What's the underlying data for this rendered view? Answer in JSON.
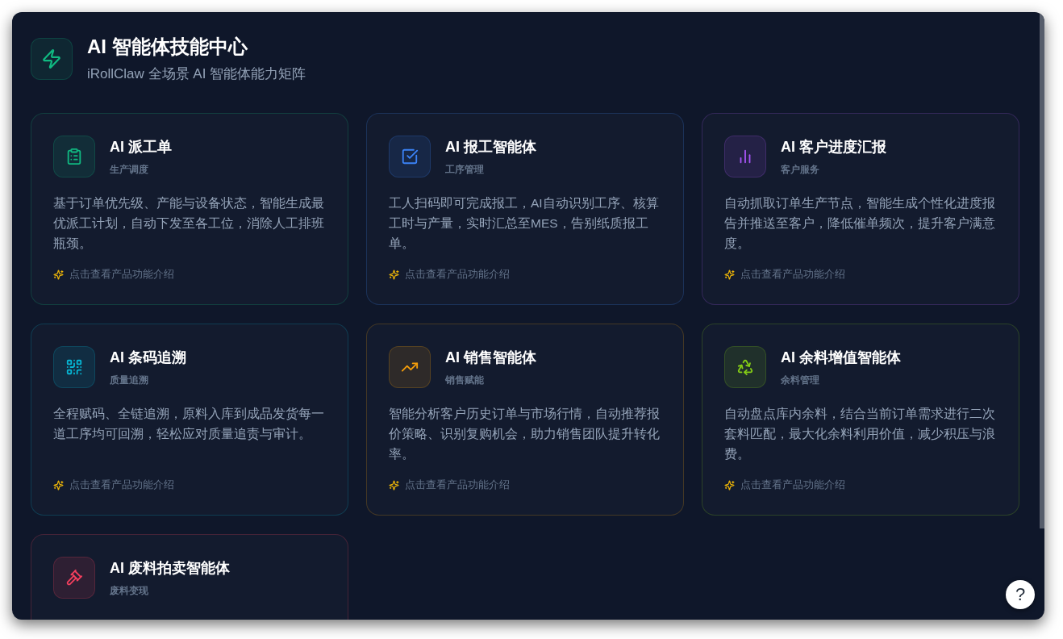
{
  "header": {
    "title": "AI 智能体技能中心",
    "subtitle": "iRollClaw 全场景 AI 智能体能力矩阵"
  },
  "cards": [
    {
      "title": "AI 派工单",
      "category": "生产调度",
      "description": "基于订单优先级、产能与设备状态，智能生成最优派工计划，自动下发至各工位，消除人工排班瓶颈。",
      "link": "点击查看产品功能介绍",
      "color": "#10b981"
    },
    {
      "title": "AI 报工智能体",
      "category": "工序管理",
      "description": "工人扫码即可完成报工，AI自动识别工序、核算工时与产量，实时汇总至MES，告别纸质报工单。",
      "link": "点击查看产品功能介绍",
      "color": "#3b82f6"
    },
    {
      "title": "AI 客户进度汇报",
      "category": "客户服务",
      "description": "自动抓取订单生产节点，智能生成个性化进度报告并推送至客户，降低催单频次，提升客户满意度。",
      "link": "点击查看产品功能介绍",
      "color": "#a855f7"
    },
    {
      "title": "AI 条码追溯",
      "category": "质量追溯",
      "description": "全程赋码、全链追溯，原料入库到成品发货每一道工序均可回溯，轻松应对质量追责与审计。",
      "link": "点击查看产品功能介绍",
      "color": "#06b6d4"
    },
    {
      "title": "AI 销售智能体",
      "category": "销售赋能",
      "description": "智能分析客户历史订单与市场行情，自动推荐报价策略、识别复购机会，助力销售团队提升转化率。",
      "link": "点击查看产品功能介绍",
      "color": "#f59e0b"
    },
    {
      "title": "AI 余料增值智能体",
      "category": "余料管理",
      "description": "自动盘点库内余料，结合当前订单需求进行二次套料匹配，最大化余料利用价值，减少积压与浪费。",
      "link": "点击查看产品功能介绍",
      "color": "#84cc16"
    },
    {
      "title": "AI 废料拍卖智能体",
      "category": "废料变现",
      "color": "#f43f5e"
    }
  ],
  "help_button": {
    "label": "?"
  }
}
